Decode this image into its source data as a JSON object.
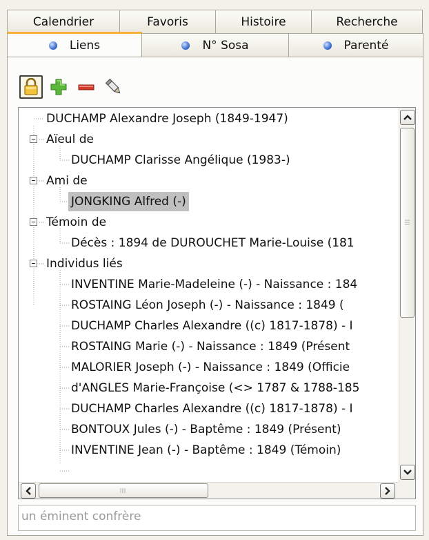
{
  "tabs_top": [
    {
      "label": "Calendrier"
    },
    {
      "label": "Favoris"
    },
    {
      "label": "Histoire"
    },
    {
      "label": "Recherche"
    }
  ],
  "tabs_bottom": [
    {
      "label": "Liens",
      "active": true
    },
    {
      "label": "N° Sosa",
      "active": false
    },
    {
      "label": "Parenté",
      "active": false
    }
  ],
  "toolbar": {
    "lock": "lock-icon",
    "add": "plus-icon",
    "remove": "minus-icon",
    "edit": "pencil-icon"
  },
  "tree": {
    "root": "DUCHAMP Alexandre Joseph (1849-1947)",
    "groups": [
      {
        "label": "Aïeul de",
        "items": [
          "DUCHAMP Clarisse Angélique (1983-)"
        ]
      },
      {
        "label": "Ami de",
        "items": [
          "JONGKING Alfred (-)"
        ],
        "selected_index": 0
      },
      {
        "label": "Témoin de",
        "items": [
          "Décès : 1894 de DUROUCHET Marie-Louise (181"
        ]
      },
      {
        "label": "Individus liés",
        "items": [
          "INVENTINE Marie-Madeleine (-) - Naissance : 184",
          "ROSTAING Léon Joseph (-) - Naissance : 1849 (",
          "DUCHAMP Charles Alexandre ((c) 1817-1878) - I",
          "ROSTAING Marie (-) - Naissance : 1849 (Présent",
          "MALORIER Joseph (-) - Naissance : 1849 (Officie",
          "d'ANGLES Marie-Françoise (<> 1787 & 1788-185",
          "DUCHAMP Charles Alexandre ((c) 1817-1878) - I",
          "BONTOUX Jules (-) - Baptême : 1849 (Présent)",
          "INVENTINE Jean (-) - Baptême : 1849 (Témoin)"
        ]
      }
    ]
  },
  "note": {
    "text": "un éminent confrère"
  }
}
